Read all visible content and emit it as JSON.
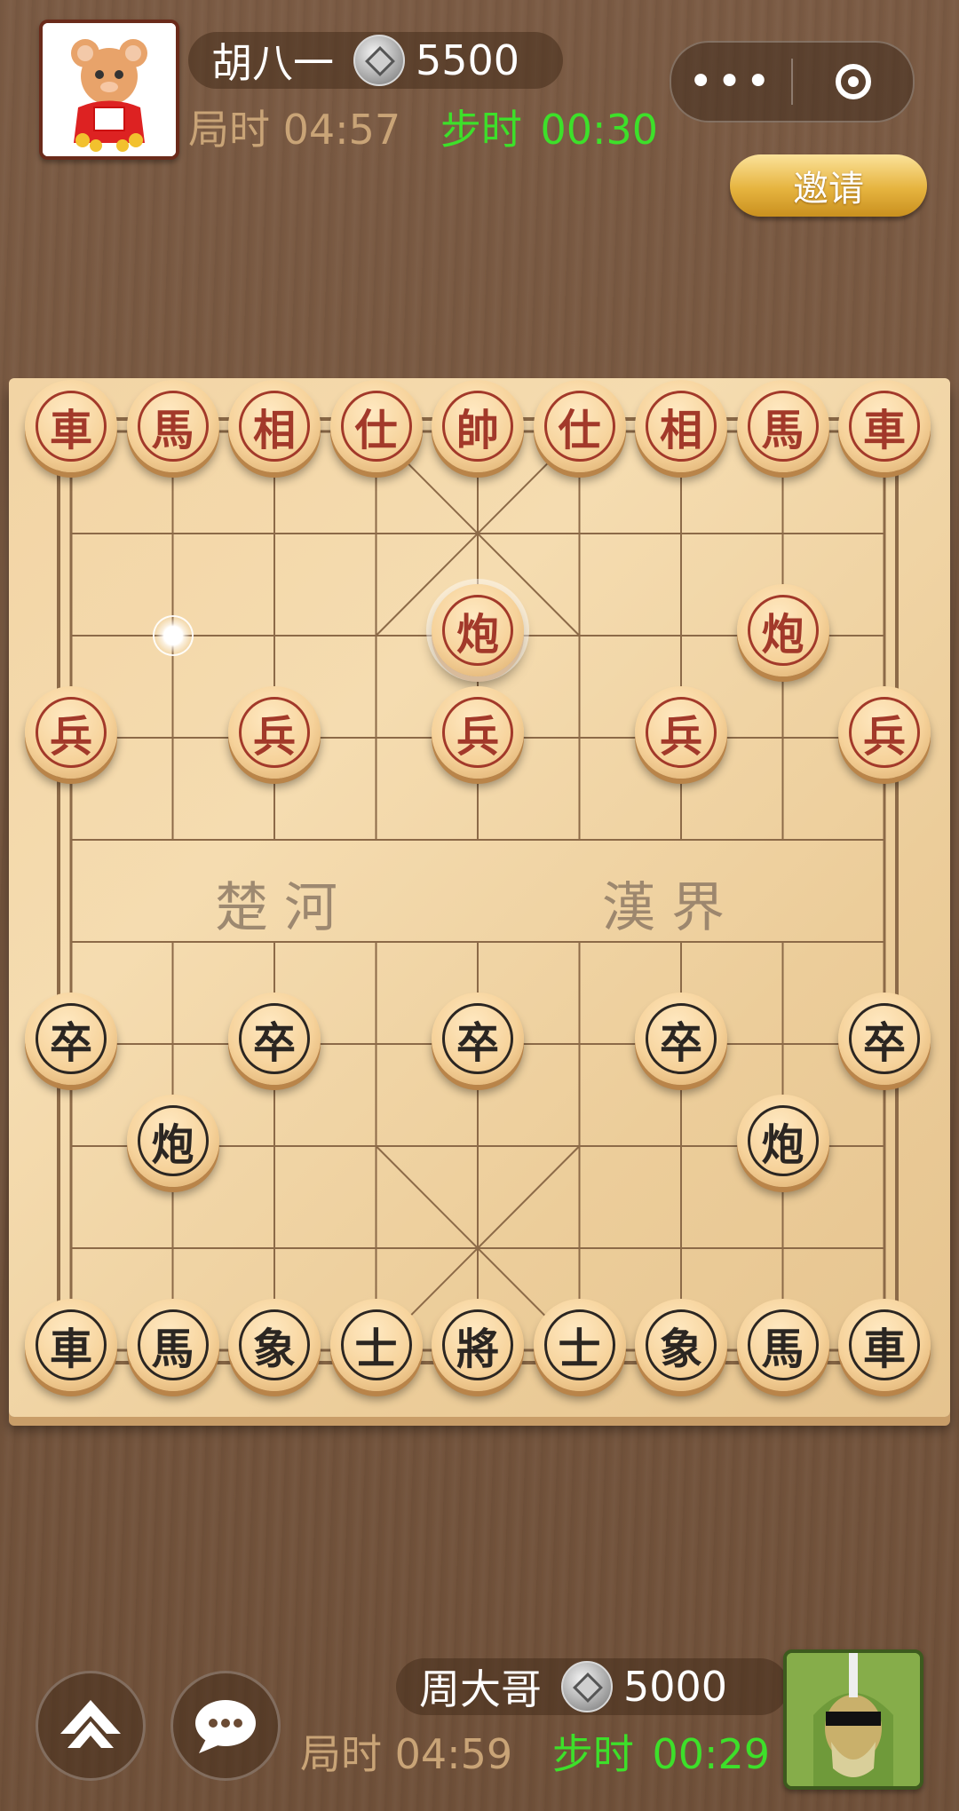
{
  "top_player": {
    "name": "胡八一",
    "coins": "5500",
    "game_time_label": "局时",
    "game_time": "04:57",
    "step_time_label": "步时",
    "step_time": "00:30"
  },
  "bottom_player": {
    "name": "周大哥",
    "coins": "5000",
    "game_time_label": "局时",
    "game_time": "04:59",
    "step_time_label": "步时",
    "step_time": "00:29"
  },
  "menu_capsule": {
    "more": "•••",
    "close_icon": "target-icon"
  },
  "invite_label": "邀请",
  "river": {
    "left": "楚河",
    "right": "漢界"
  },
  "colors": {
    "red_piece": "#a2392a",
    "black_piece": "#2b2622",
    "step_timer": "#3de02a",
    "game_timer": "#c9a477"
  },
  "pieces": [
    {
      "side": "red",
      "char": "車",
      "col": 0,
      "row": 0
    },
    {
      "side": "red",
      "char": "馬",
      "col": 1,
      "row": 0
    },
    {
      "side": "red",
      "char": "相",
      "col": 2,
      "row": 0
    },
    {
      "side": "red",
      "char": "仕",
      "col": 3,
      "row": 0
    },
    {
      "side": "red",
      "char": "帥",
      "col": 4,
      "row": 0
    },
    {
      "side": "red",
      "char": "仕",
      "col": 5,
      "row": 0
    },
    {
      "side": "red",
      "char": "相",
      "col": 6,
      "row": 0
    },
    {
      "side": "red",
      "char": "馬",
      "col": 7,
      "row": 0
    },
    {
      "side": "red",
      "char": "車",
      "col": 8,
      "row": 0
    },
    {
      "side": "red",
      "char": "炮",
      "col": 4,
      "row": 2,
      "selected": true
    },
    {
      "side": "red",
      "char": "炮",
      "col": 7,
      "row": 2
    },
    {
      "side": "red",
      "char": "兵",
      "col": 0,
      "row": 3
    },
    {
      "side": "red",
      "char": "兵",
      "col": 2,
      "row": 3
    },
    {
      "side": "red",
      "char": "兵",
      "col": 4,
      "row": 3
    },
    {
      "side": "red",
      "char": "兵",
      "col": 6,
      "row": 3
    },
    {
      "side": "red",
      "char": "兵",
      "col": 8,
      "row": 3
    },
    {
      "side": "black",
      "char": "卒",
      "col": 0,
      "row": 6
    },
    {
      "side": "black",
      "char": "卒",
      "col": 2,
      "row": 6
    },
    {
      "side": "black",
      "char": "卒",
      "col": 4,
      "row": 6
    },
    {
      "side": "black",
      "char": "卒",
      "col": 6,
      "row": 6
    },
    {
      "side": "black",
      "char": "卒",
      "col": 8,
      "row": 6
    },
    {
      "side": "black",
      "char": "炮",
      "col": 1,
      "row": 7
    },
    {
      "side": "black",
      "char": "炮",
      "col": 7,
      "row": 7
    },
    {
      "side": "black",
      "char": "車",
      "col": 0,
      "row": 9
    },
    {
      "side": "black",
      "char": "馬",
      "col": 1,
      "row": 9
    },
    {
      "side": "black",
      "char": "象",
      "col": 2,
      "row": 9
    },
    {
      "side": "black",
      "char": "士",
      "col": 3,
      "row": 9
    },
    {
      "side": "black",
      "char": "將",
      "col": 4,
      "row": 9
    },
    {
      "side": "black",
      "char": "士",
      "col": 5,
      "row": 9
    },
    {
      "side": "black",
      "char": "象",
      "col": 6,
      "row": 9
    },
    {
      "side": "black",
      "char": "馬",
      "col": 7,
      "row": 9
    },
    {
      "side": "black",
      "char": "車",
      "col": 8,
      "row": 9
    }
  ],
  "last_move_marker": {
    "col": 1,
    "row": 2
  },
  "bottom_controls": [
    {
      "name": "up-arrow-icon"
    },
    {
      "name": "chat-icon"
    }
  ]
}
